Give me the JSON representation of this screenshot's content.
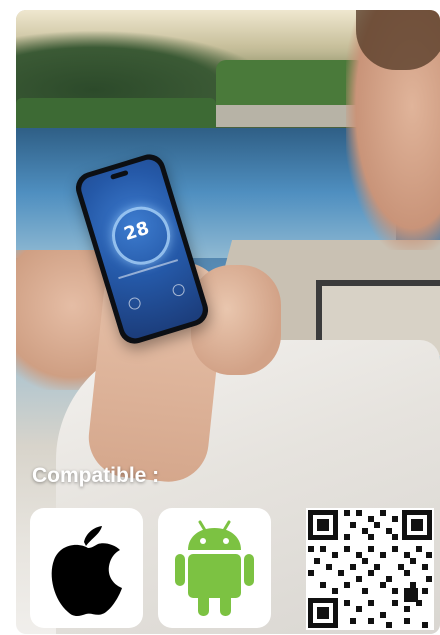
{
  "phone": {
    "temperature": "28"
  },
  "compatibility": {
    "label": "Compatible :",
    "platforms": [
      {
        "name": "apple-logo"
      },
      {
        "name": "android-logo"
      }
    ]
  },
  "colors": {
    "android_green": "#7cc242",
    "apple_black": "#000000",
    "screen_blue": "#2559a8"
  },
  "icons": [
    "apple-icon",
    "android-icon",
    "qr-code-icon"
  ]
}
